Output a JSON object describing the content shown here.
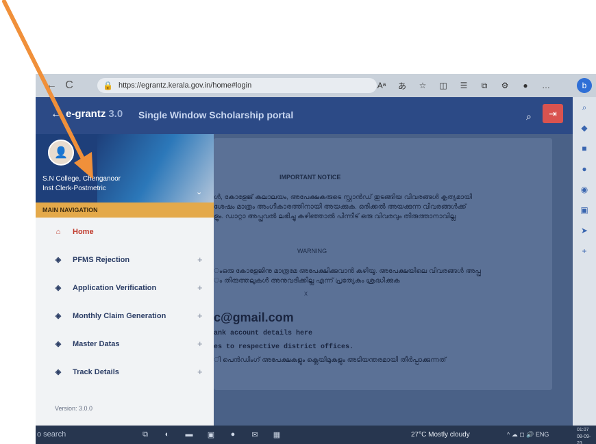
{
  "browser": {
    "url": "https://egrantz.kerala.gov.in/home#login",
    "reader_label": "Aᵃ",
    "edge_sidebar_icons": [
      "search-icon",
      "tag-icon",
      "shopping-icon",
      "people-icon",
      "circle-icon",
      "outlook-icon",
      "send-icon",
      "add-icon"
    ],
    "bing_label": "b"
  },
  "header": {
    "brand": "e-grantz",
    "version": "3.0",
    "title": "Single Window Scholarship portal"
  },
  "sidebar": {
    "college": "S.N College, Chenganoor",
    "role": "Inst Clerk-Postmetric",
    "main_nav_label": "MAIN NAVIGATION",
    "items": [
      {
        "label": "Home"
      },
      {
        "label": "PFMS Rejection"
      },
      {
        "label": "Application Verification"
      },
      {
        "label": "Monthly Claim Generation"
      },
      {
        "label": "Master Datas"
      },
      {
        "label": "Track Details"
      }
    ],
    "version": "Version: 3.0.0"
  },
  "content": {
    "notice_title": "IMPORTANT NOTICE",
    "notice_lines": [
      "ൾ, കോളേജ് കലാലയം, അപേക്ഷകരുടെ സ്റ്റാൻഡ് തുടങ്ങിയ വിവരങ്ങൾ കൃത്യമായി",
      "ശേഷം മാത്രം അംഗീകാരത്തിനായി അയക്കുക. ഒരിക്കൽ അയക്കുന്ന വിവരങ്ങൾക്ക്",
      "ളും. ഡാറ്റാ അപ്പ്രൂവൽ ലഭിച്ചു കഴിഞ്ഞാൽ പിന്നീട് ഒരു വിവരവും തിരുത്താനാവില്ല"
    ],
    "warning_title": "WARNING",
    "warning_lines": [
      "ംഒരു കോളേജിനു മാത്രമേ അപേക്ഷിക്കുവാൻ കഴിയൂ. അപേക്ഷയിലെ വിവരങ്ങൾ അപ്പ്രൂ",
      "ം തിരുത്തലുകൾ അനുവദിക്കില്ല എന്ന് പ്രത്യേകം ശ്രദ്ധിക്കുക"
    ],
    "close": "x",
    "email": "c@gmail.com",
    "bank_line": "ank account details here",
    "district_line": "es to respective district offices.",
    "bottom_line": "ി പെൻഡിംഗ് അപേക്ഷകളും ക്ലെയിമുകളും അടിയന്തരമായി തീർപ്പാക്കുന്നത്"
  },
  "taskbar": {
    "search": "o search",
    "weather": "27°C  Mostly cloudy",
    "lang": "ENG",
    "time": "01:07",
    "date": "08-09-23"
  },
  "colors": {
    "header": "#2c4a86",
    "main_nav": "#e4a94a",
    "active_item": "#c0392b",
    "arrow": "#f0903a"
  }
}
